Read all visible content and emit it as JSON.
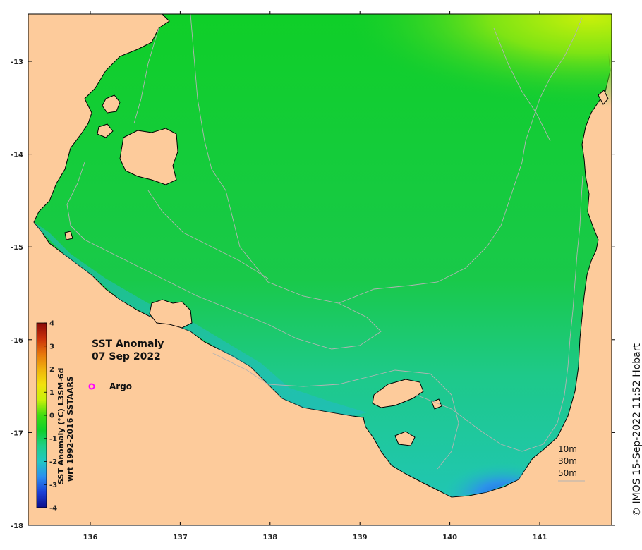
{
  "map": {
    "title": "SST Anomaly",
    "date": "07 Sep 2022",
    "legend_marker_label": "Argo",
    "legend_marker_color": "#ff00ff",
    "land_color": "#fdcb9b",
    "coast_color": "#000000",
    "contour_color": "#b3b3b3",
    "contour_labels": [
      "10m",
      "30m",
      "50m"
    ],
    "x_ticks": [
      "136",
      "137",
      "138",
      "139",
      "140",
      "141"
    ],
    "y_ticks": [
      "-13",
      "-14",
      "-15",
      "-16",
      "-17",
      "-18"
    ],
    "credit": "© IMOS 15-Sep-2022 11:52 Hobart"
  },
  "colorbar": {
    "label_line1": "SST Anomaly (°C) L3SM-6d",
    "label_line2": "wrt 1992-2016 SSTAARS",
    "ticks": [
      "4",
      "3",
      "2",
      "1",
      "0",
      "-1",
      "-2",
      "-3",
      "-4"
    ],
    "range": [
      -4,
      4
    ],
    "colors": [
      "#0b0e8a",
      "#1a3fd6",
      "#2b8df0",
      "#20c6c4",
      "#1ecf8a",
      "#0fcf2c",
      "#3fdc10",
      "#c8f00a",
      "#f2e10c",
      "#f0b20c",
      "#e7760b",
      "#c9300a",
      "#8a0a08"
    ]
  },
  "field_colors": {
    "cold_deep": "#2a86e6",
    "cold": "#1ec7b2",
    "neutral_teal": "#19c98e",
    "neutral": "#12c940",
    "warm": "#34d81a",
    "warmer": "#9be812",
    "warmest": "#c8f00a"
  }
}
